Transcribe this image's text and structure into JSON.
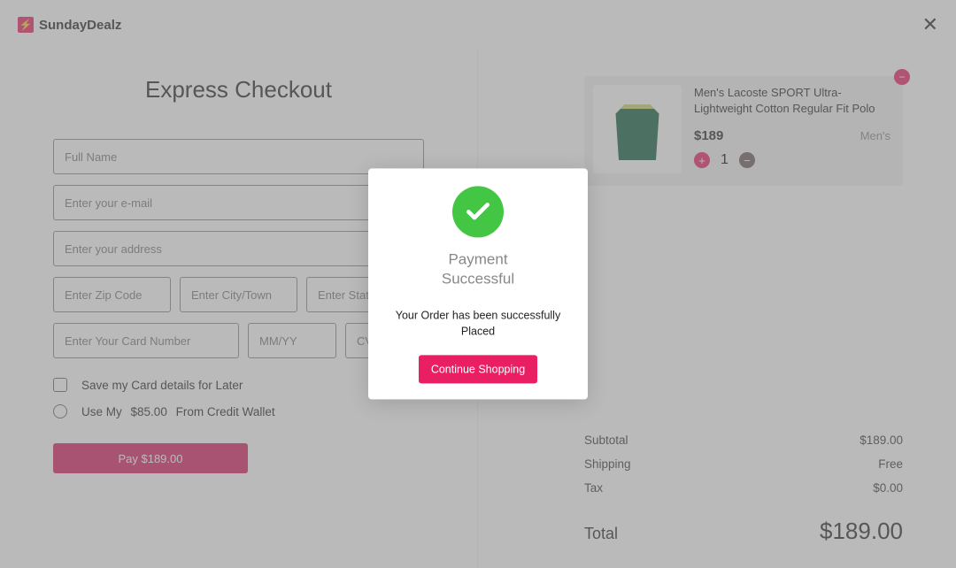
{
  "brand": "SundayDealz",
  "checkout": {
    "title": "Express Checkout",
    "placeholders": {
      "name": "Full Name",
      "email": "Enter your e-mail",
      "address": "Enter your address",
      "zip": "Enter Zip Code",
      "city": "Enter City/Town",
      "state": "Enter State",
      "card": "Enter Your Card Number",
      "exp": "MM/YY",
      "cvc": "CVC"
    },
    "save_card_label": "Save my Card details for Later",
    "wallet_prefix": "Use My",
    "wallet_amount": "$85.00",
    "wallet_suffix": "From Credit Wallet",
    "pay_label": "Pay $189.00"
  },
  "cart": {
    "item": {
      "name": "Men's Lacoste SPORT Ultra-Lightweight Cotton Regular Fit Polo",
      "price": "$189",
      "category": "Men's",
      "qty": "1"
    },
    "summary": {
      "subtotal_label": "Subtotal",
      "subtotal_value": "$189.00",
      "shipping_label": "Shipping",
      "shipping_value": "Free",
      "tax_label": "Tax",
      "tax_value": "$0.00",
      "total_label": "Total",
      "total_value": "$189.00"
    }
  },
  "modal": {
    "title_line1": "Payment",
    "title_line2": "Successful",
    "message": "Your Order has been successfully Placed",
    "button": "Continue Shopping"
  }
}
